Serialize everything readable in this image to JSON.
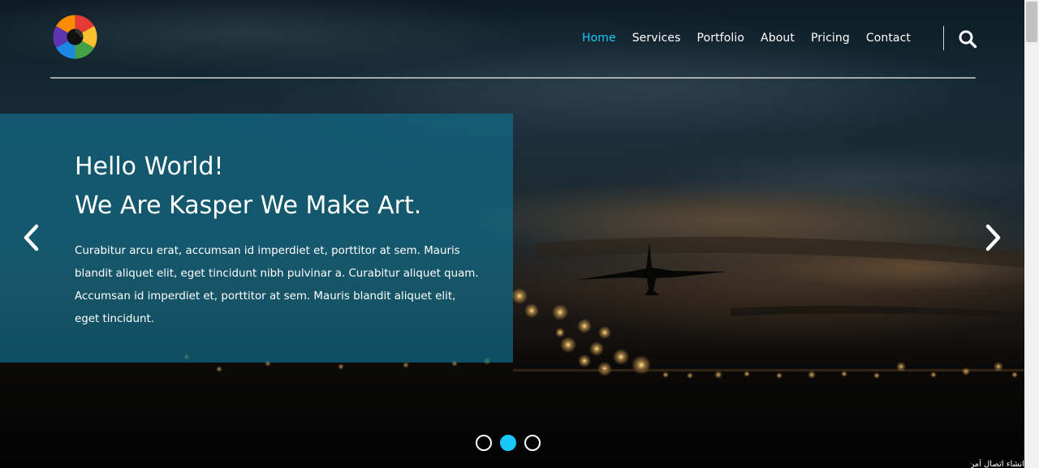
{
  "nav": {
    "items": [
      {
        "label": "Home",
        "active": true
      },
      {
        "label": "Services",
        "active": false
      },
      {
        "label": "Portfolio",
        "active": false
      },
      {
        "label": "About",
        "active": false
      },
      {
        "label": "Pricing",
        "active": false
      },
      {
        "label": "Contact",
        "active": false
      }
    ]
  },
  "intro": {
    "title_line1": "Hello World!",
    "title_line2": "We Are Kasper We Make Art.",
    "text": "Curabitur arcu erat, accumsan id imperdiet et, porttitor at sem. Mauris blandit aliquet elit, eget tincidunt nibh pulvinar a. Curabitur aliquet quam. Accumsan id imperdiet et, porttitor at sem. Mauris blandit aliquet elit, eget tincidunt."
  },
  "slider": {
    "bullet_count": 3,
    "active_index": 1
  },
  "overlay": {
    "corner_text": "انشاء اتصال آمن"
  },
  "icons": {
    "logo": "rainbow-spiral-logo-icon",
    "search": "search-icon",
    "prev": "chevron-left-icon",
    "next": "chevron-right-icon"
  },
  "colors": {
    "accent": "#19c8fa",
    "intro_box": "#106e8c"
  }
}
